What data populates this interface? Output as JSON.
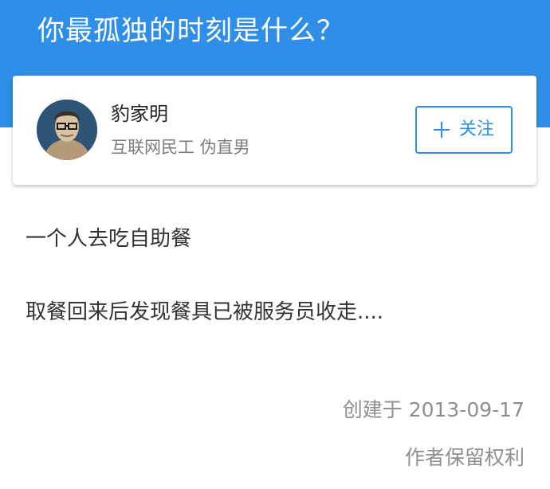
{
  "header": {
    "title": "你最孤独的时刻是什么？"
  },
  "author": {
    "name": "豹家明",
    "bio": "互联网民工 伪直男",
    "follow_label": "关注"
  },
  "answer": {
    "lines": [
      "一个人去吃自助餐",
      "取餐回来后发现餐具已被服务员收走...."
    ]
  },
  "meta": {
    "created": "创建于 2013-09-17",
    "rights": "作者保留权利"
  },
  "colors": {
    "brand": "#2f8ee7",
    "text_primary": "#333333",
    "text_secondary": "#7d7d7d"
  },
  "icons": {
    "follow": "plus-icon",
    "avatar": "avatar"
  }
}
